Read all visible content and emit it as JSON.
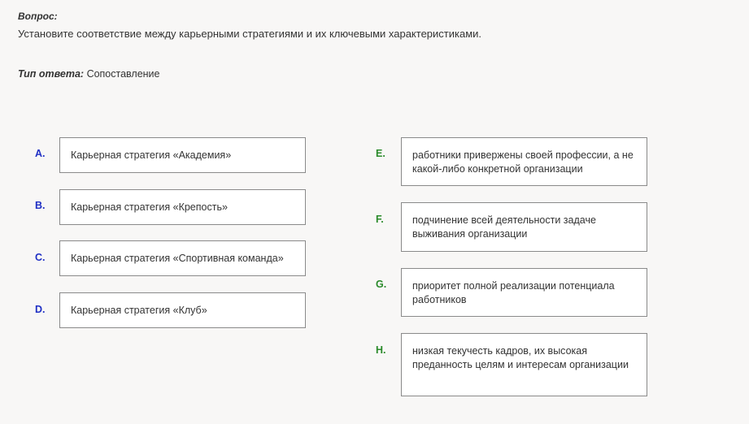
{
  "question": {
    "label": "Вопрос:",
    "text": "Установите соответствие между карьерными стратегиями и их ключевыми характеристиками."
  },
  "answer_type": {
    "label": "Тип ответа:",
    "value": "Сопоставление"
  },
  "left_items": [
    {
      "letter": "A.",
      "text": "Карьерная стратегия «Академия»"
    },
    {
      "letter": "B.",
      "text": "Карьерная стратегия «Крепость»"
    },
    {
      "letter": "C.",
      "text": "Карьерная стратегия «Спортивная команда»"
    },
    {
      "letter": "D.",
      "text": "Карьерная стратегия «Клуб»"
    }
  ],
  "right_items": [
    {
      "letter": "E.",
      "text": "работники привержены своей профессии, а не какой-либо конкретной организации"
    },
    {
      "letter": "F.",
      "text": "подчинение всей деятельности задаче выживания организации"
    },
    {
      "letter": "G.",
      "text": "приоритет полной реализации потенциала работников"
    },
    {
      "letter": "H.",
      "text": "низкая текучесть кадров, их высокая преданность целям и интересам организации"
    }
  ],
  "colors": {
    "left_letter": "#1f2fc4",
    "right_letter": "#2a8a2a",
    "background": "#f8f7f6",
    "box_border": "#8a8a8a"
  }
}
